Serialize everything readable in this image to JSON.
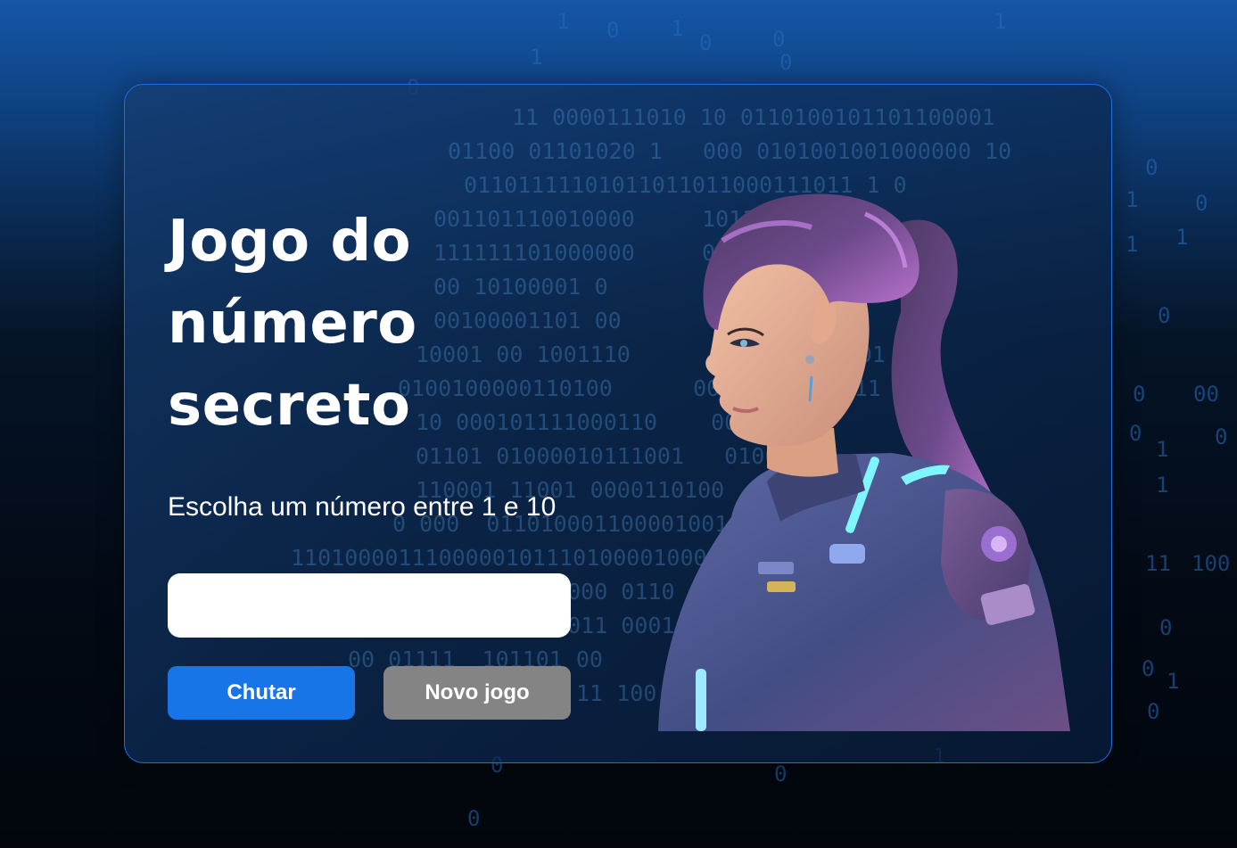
{
  "game": {
    "title": "Jogo do número secreto",
    "prompt": "Escolha um número entre 1 e 10",
    "input_value": "",
    "buttons": {
      "guess_label": "Chutar",
      "new_game_label": "Novo jogo"
    }
  },
  "illustration": {
    "subject": "astronaut-girl-illustration"
  },
  "background": {
    "decoration": "binary-code-rain"
  },
  "colors": {
    "card_border": "#1f6fe0",
    "guess_button": "#1875e8",
    "new_game_button": "#848484",
    "text": "#ffffff"
  }
}
